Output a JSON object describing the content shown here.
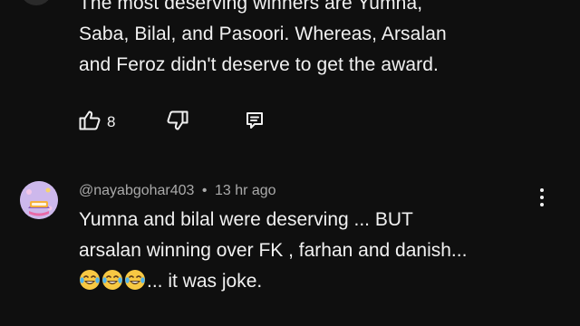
{
  "comment_1": {
    "text_lines": [
      "The most deserving winners are Yumna,",
      "Saba, Bilal, and Pasoori. Whereas, Arsalan",
      "and Feroz didn't deserve to get the award."
    ],
    "like_count": "8",
    "icons": {
      "like": "thumbs-up-icon",
      "dislike": "thumbs-down-icon",
      "reply": "reply-icon"
    }
  },
  "comment_2": {
    "author": "@nayabgohar403",
    "separator": "•",
    "timestamp": "13 hr ago",
    "text_lines": [
      "Yumna and bilal were deserving ... BUT",
      "arsalan winning over FK , farhan and danish..."
    ],
    "last_line_suffix": "... it was joke.",
    "emoji": [
      "laughing-crying-emoji",
      "laughing-crying-emoji",
      "laughing-crying-emoji"
    ],
    "icons": {
      "menu": "more-vert-icon"
    }
  },
  "colors": {
    "background": "#0f0f0f",
    "text": "#f1f1f1",
    "secondary_text": "#aaaaaa"
  }
}
